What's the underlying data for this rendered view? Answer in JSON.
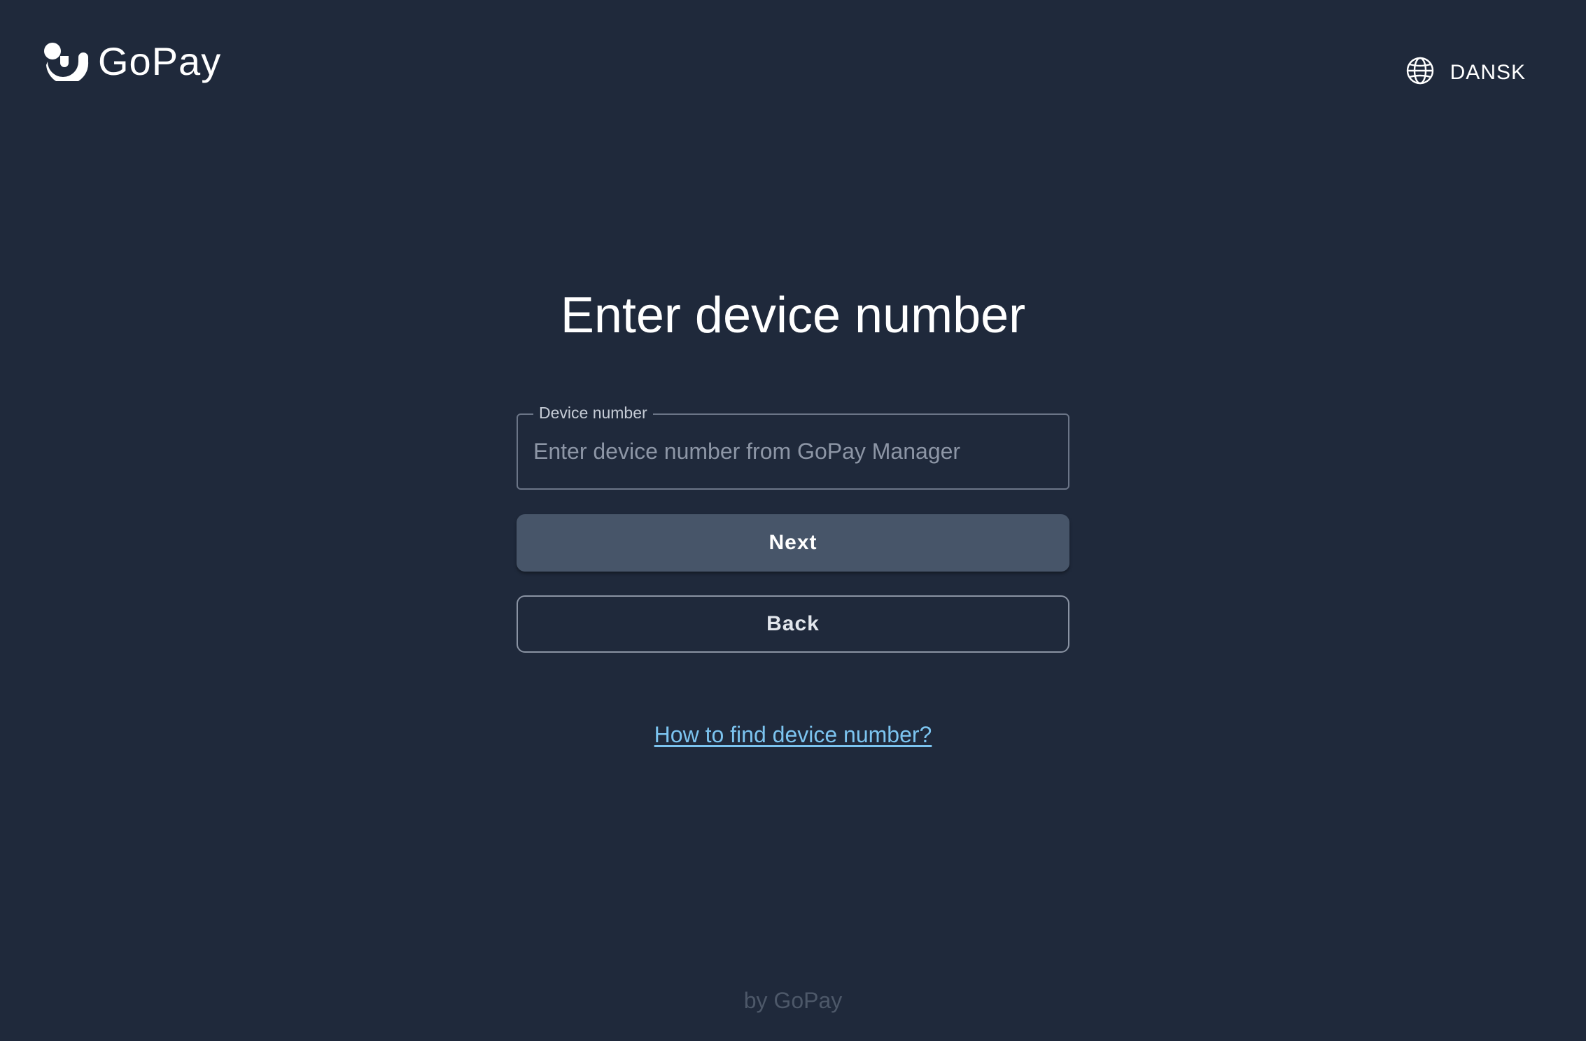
{
  "header": {
    "logo_text": "GoPay",
    "logo_icon": "gopay-smile-logo",
    "language_icon": "globe-icon",
    "language_label": "DANSK"
  },
  "main": {
    "title": "Enter device number",
    "device_field": {
      "label": "Device number",
      "placeholder": "Enter device number from GoPay Manager",
      "value": ""
    },
    "next_label": "Next",
    "back_label": "Back",
    "help_link": "How to find device number?"
  },
  "footer": {
    "text": "by GoPay"
  },
  "colors": {
    "background": "#1f293b",
    "primary_button": "#475569",
    "link": "#7cc4f0",
    "footer_text": "#4d5869"
  }
}
